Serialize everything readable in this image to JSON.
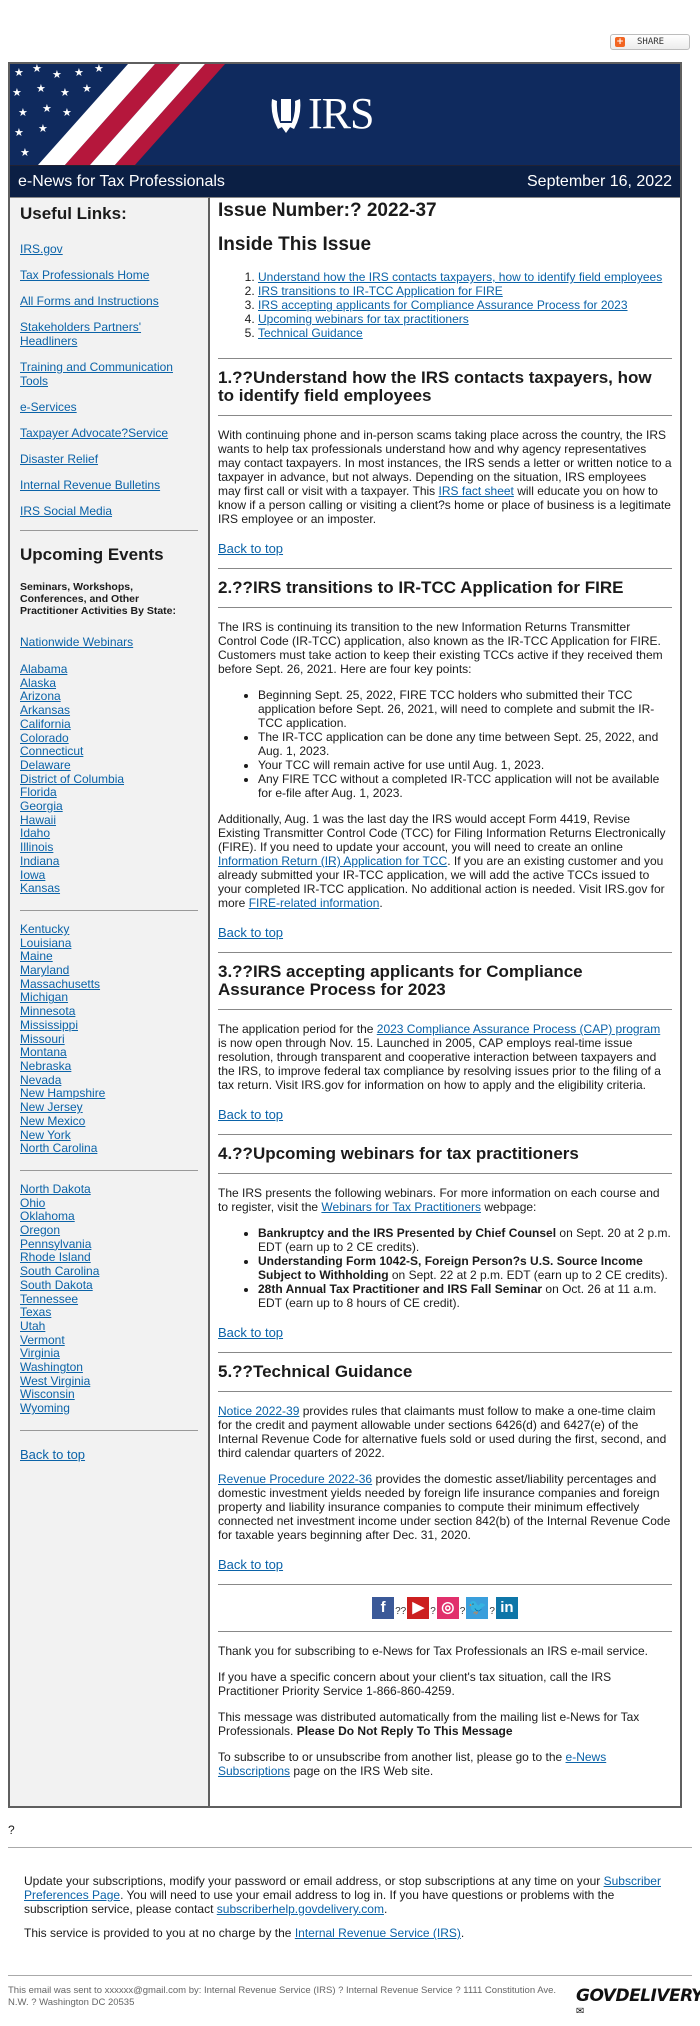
{
  "share": {
    "label": "SHARE",
    "icon": "plus-icon"
  },
  "header": {
    "logo_text": "IRS",
    "newsletter_title": "e-News for Tax Professionals",
    "date": "September 16, 2022",
    "colors": {
      "navy": "#0f2a5e",
      "dark_navy": "#0b1f44",
      "red": "#b5173c"
    }
  },
  "sidebar": {
    "useful_links_title": "Useful Links:",
    "useful_links": [
      "IRS.gov",
      "Tax Professionals Home",
      "All Forms and Instructions",
      "Stakeholders Partners' Headliners",
      "Training and Communication Tools",
      "e-Services",
      "Taxpayer Advocate?Service",
      "Disaster Relief",
      "Internal Revenue Bulletins",
      "IRS Social Media"
    ],
    "events_title": "Upcoming Events",
    "events_subtitle": "Seminars, Workshops, Conferences, and Other Practitioner Activities By State:",
    "nationwide": "Nationwide Webinars",
    "states_group1": [
      "Alabama",
      "Alaska",
      "Arizona",
      "Arkansas",
      "California",
      "Colorado",
      "Connecticut",
      "Delaware",
      "District of Columbia",
      "Florida",
      "Georgia",
      "Hawaii",
      "Idaho",
      "Illinois",
      "Indiana",
      "Iowa",
      "Kansas"
    ],
    "states_group2": [
      "Kentucky",
      "Louisiana",
      "Maine",
      "Maryland",
      "Massachusetts",
      "Michigan",
      "Minnesota",
      "Mississippi",
      "Missouri",
      "Montana",
      "Nebraska",
      "Nevada",
      "New Hampshire",
      "New Jersey",
      "New Mexico",
      "New York",
      "North Carolina"
    ],
    "states_group3": [
      "North Dakota",
      "Ohio",
      "Oklahoma",
      "Oregon",
      "Pennsylvania",
      "Rhode Island",
      "South Carolina",
      "South Dakota",
      "Tennessee",
      "Texas",
      "Utah",
      "Vermont",
      "Virginia",
      "Washington",
      "West Virginia",
      "Wisconsin",
      "Wyoming"
    ],
    "back_to_top": "Back to top"
  },
  "main": {
    "issue_number": "Issue Number:? 2022-37",
    "inside_title": "Inside This Issue",
    "toc": [
      "Understand how the IRS contacts taxpayers, how to identify field employees",
      "IRS transitions to IR-TCC Application for FIRE",
      "IRS accepting applicants for Compliance Assurance Process for 2023",
      "Upcoming webinars for tax practitioners",
      "Technical Guidance"
    ],
    "back_to_top": "Back to top",
    "s1": {
      "title": "1.??Understand how the IRS contacts taxpayers, how to identify field employees",
      "p1_before": "With continuing phone and in-person scams taking place across the country, the IRS wants to help tax professionals understand how and why agency representatives may contact taxpayers. In most instances, the IRS sends a letter or written notice to a taxpayer in advance, but not always. Depending on the situation, IRS employees may first call or visit with a taxpayer. This ",
      "p1_link": "IRS fact sheet",
      "p1_after": " will educate you on how to know if a person calling or visiting a client?s home or place of business is a legitimate IRS employee or an imposter."
    },
    "s2": {
      "title": "2.??IRS transitions to IR-TCC Application for FIRE",
      "p1": "The IRS is continuing its transition to the new Information Returns Transmitter Control Code (IR-TCC) application, also known as the IR-TCC Application for FIRE. Customers must take action to keep their existing TCCs active if they received them before Sept. 26, 2021. Here are four key points:",
      "bullets": [
        "Beginning Sept. 25, 2022, FIRE TCC holders who submitted their TCC application before Sept. 26, 2021, will need to complete and submit the IR-TCC application.",
        "The IR-TCC application can be done any time between Sept. 25, 2022, and Aug. 1, 2023.",
        "Your TCC will remain active for use until Aug. 1, 2023.",
        "Any FIRE TCC without a completed IR-TCC application will not be available for e-file after Aug. 1, 2023."
      ],
      "p2_a": "Additionally, Aug. 1 was the last day the IRS would accept Form 4419, Revise Existing Transmitter Control Code (TCC) for Filing Information Returns Electronically (FIRE). If you need to update your account, you will need to create an online ",
      "p2_link1": "Information Return (IR) Application for TCC",
      "p2_b": ". If you are an existing customer and you already submitted your IR-TCC application, we will add the active TCCs issued to your completed IR-TCC application. No additional action is needed. Visit IRS.gov for more ",
      "p2_link2": "FIRE-related information",
      "p2_c": "."
    },
    "s3": {
      "title": "3.??IRS accepting applicants for Compliance Assurance Process for 2023",
      "p_a": "The application period for the ",
      "p_link": "2023 Compliance Assurance Process (CAP) program",
      "p_b": " is now open through Nov. 15. Launched in 2005, CAP employs real-time issue resolution, through transparent and cooperative interaction between taxpayers and the IRS, to improve federal tax compliance by resolving issues prior to the filing of a tax return. Visit IRS.gov for information on how to apply and the eligibility criteria."
    },
    "s4": {
      "title": "4.??Upcoming webinars for tax practitioners",
      "p_a": "The IRS presents the following webinars. For more information on each course and to register, visit the ",
      "p_link": "Webinars for Tax Practitioners",
      "p_b": " webpage:",
      "webinars": [
        {
          "name": "Bankruptcy and the IRS Presented by Chief Counsel",
          "detail": " on Sept. 20 at 2 p.m. EDT (earn up to 2 CE credits)."
        },
        {
          "name": "Understanding Form 1042-S, Foreign Person?s U.S. Source Income Subject to Withholding",
          "detail": " on Sept. 22 at 2 p.m. EDT (earn up to 2 CE credits)."
        },
        {
          "name": "28th Annual Tax Practitioner and IRS Fall Seminar",
          "detail": " on Oct. 26 at 11 a.m. EDT (earn up to 8 hours of CE credit)."
        }
      ]
    },
    "s5": {
      "title": "5.??Technical Guidance",
      "p1_link": "Notice 2022-39",
      "p1": " provides rules that claimants must follow to make a one-time claim for the credit and payment allowable under sections 6426(d) and 6427(e) of the Internal Revenue Code for alternative fuels sold or used during the first, second, and third calendar quarters of 2022.",
      "p2_link": "Revenue Procedure 2022-36",
      "p2": " provides the domestic asset/liability percentages and domestic investment yields needed by foreign life insurance companies and foreign property and liability insurance companies to compute their minimum effectively connected net investment income under section 842(b) of the Internal Revenue Code for taxable years beginning after Dec. 31, 2020."
    },
    "social": {
      "separators": [
        "??",
        "?",
        "?",
        "?"
      ],
      "icons": [
        {
          "name": "facebook-icon",
          "glyph": "f",
          "color": "#3b5998"
        },
        {
          "name": "youtube-icon",
          "glyph": "▶",
          "color": "#cc1f1f"
        },
        {
          "name": "instagram-icon",
          "glyph": "◎",
          "color": "#e1306c"
        },
        {
          "name": "twitter-icon",
          "glyph": "🐦",
          "color": "#3a9fdc"
        },
        {
          "name": "linkedin-icon",
          "glyph": "in",
          "color": "#0e76a8"
        }
      ]
    },
    "closing": {
      "thanks": "Thank you for subscribing to e-News for Tax Professionals an IRS e-mail service.",
      "concern": "If you have a specific concern about your client's tax situation, call the IRS Practitioner Priority Service 1-866-860-4259.",
      "distributed": "This message was distributed automatically from the mailing list e-News for Tax Professionals. ",
      "no_reply": "Please Do Not Reply To This Message",
      "subscribe_a": "To subscribe to or unsubscribe from another list, please go to the ",
      "subscribe_link": "e-News Subscriptions",
      "subscribe_b": " page on the IRS Web site."
    }
  },
  "after_frame": {
    "question_mark": "?",
    "pref_a": "Update your subscriptions, modify your password or email address, or stop subscriptions at any time on your ",
    "pref_link": "Subscriber Preferences Page",
    "pref_b": ". You will need to use your email address to log in. If you have questions or problems with the subscription service, please contact ",
    "help_link": "subscriberhelp.govdelivery.com",
    "pref_c": ".",
    "service_a": "This service is provided to you at no charge by the ",
    "service_link": "Internal Revenue Service (IRS)",
    "service_b": ".",
    "sent_to": "This email was sent to xxxxxx@gmail.com by: Internal Revenue Service (IRS) ? Internal Revenue Service ? 1111 Constitution Ave. N.W. ? Washington DC 20535",
    "govdelivery_logo": "GOVDELIVERY"
  }
}
